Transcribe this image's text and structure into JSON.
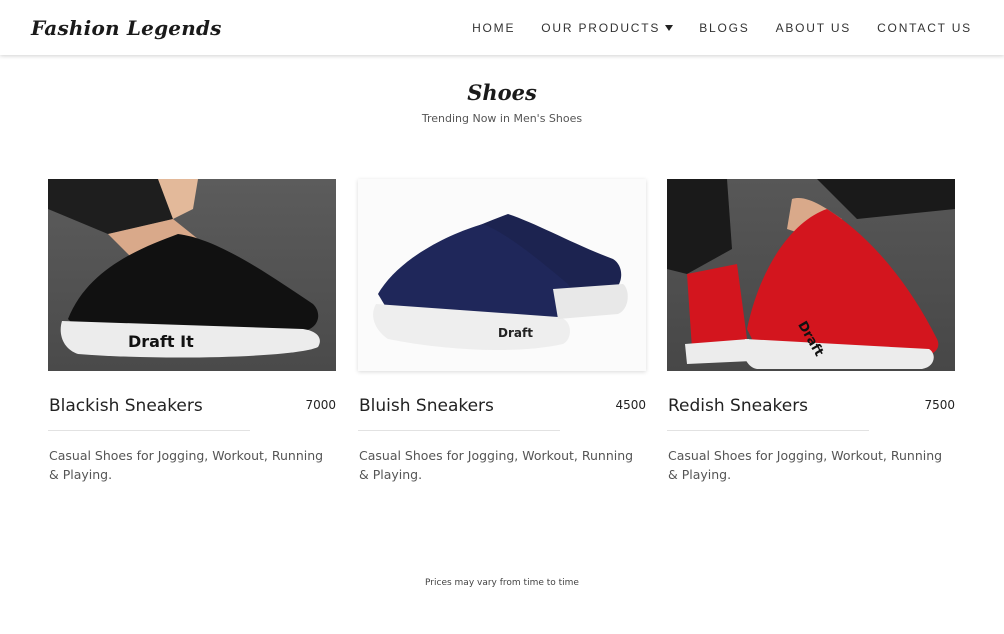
{
  "brand": {
    "name": "Fashion Legends"
  },
  "nav": {
    "items": [
      {
        "label": "HOME"
      },
      {
        "label": "OUR PRODUCTS"
      },
      {
        "label": "BLOGS"
      },
      {
        "label": "ABOUT US"
      },
      {
        "label": "CONTACT US"
      }
    ]
  },
  "section": {
    "title": "Shoes",
    "subtitle": "Trending Now in Men's Shoes"
  },
  "products": [
    {
      "name": "Blackish Sneakers",
      "price": "7000",
      "description": "Casual Shoes for Jogging, Workout, Running & Playing.",
      "image_icon": "black-sneaker-image",
      "shoe_color": "#111111"
    },
    {
      "name": "Bluish Sneakers",
      "price": "4500",
      "description": "Casual Shoes for Jogging, Workout, Running & Playing.",
      "image_icon": "navy-sneaker-image",
      "shoe_color": "#1c2350"
    },
    {
      "name": "Redish Sneakers",
      "price": "7500",
      "description": "Casual Shoes for Jogging, Workout, Running & Playing.",
      "image_icon": "red-sneaker-image",
      "shoe_color": "#d3151e"
    }
  ],
  "footer": {
    "note": "Prices may vary from time to time"
  }
}
